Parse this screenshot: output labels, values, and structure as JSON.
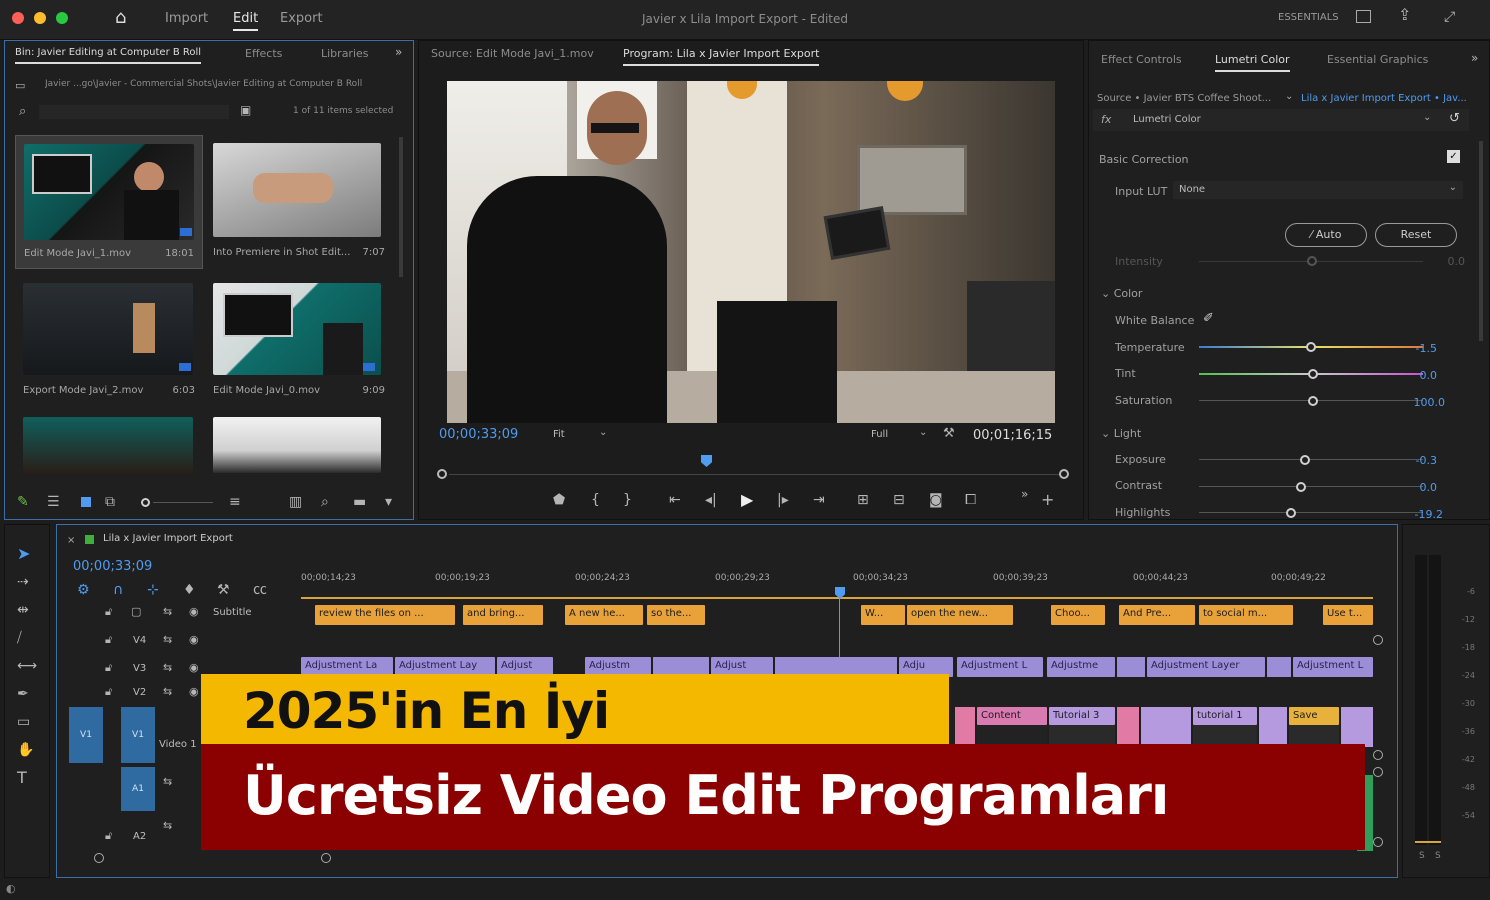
{
  "topbar": {
    "nav": [
      "Import",
      "Edit",
      "Export"
    ],
    "title": "Javier x Lila Import Export - Edited",
    "workspace": "ESSENTIALS"
  },
  "project_panel": {
    "tabs": [
      "Bin: Javier Editing at Computer B Roll",
      "Effects",
      "Libraries"
    ],
    "path": "Javier ...go\\Javier - Commercial Shots\\Javier Editing at Computer B Roll",
    "selection": "1 of 11 items selected",
    "items": [
      {
        "name": "Edit Mode Javi_1.mov",
        "duration": "18:01"
      },
      {
        "name": "Into Premiere in Shot Edit...",
        "duration": "7:07"
      },
      {
        "name": "Export Mode Javi_2.mov",
        "duration": "6:03"
      },
      {
        "name": "Edit Mode Javi_0.mov",
        "duration": "9:09"
      },
      {
        "name": "",
        "duration": ""
      },
      {
        "name": "",
        "duration": ""
      }
    ]
  },
  "monitor": {
    "tabs": [
      "Source: Edit Mode Javi_1.mov",
      "Program: Lila x Javier Import Export"
    ],
    "timecode_left": "00;00;33;09",
    "fit": "Fit",
    "quality": "Full",
    "timecode_right": "00;01;16;15"
  },
  "right_panel": {
    "tabs": [
      "Effect Controls",
      "Lumetri Color",
      "Essential Graphics"
    ],
    "source": "Source • Javier BTS Coffee Shoot...",
    "target": "Lila x Javier Import Export • Jav...",
    "effect": "Lumetri Color",
    "basic_correction": "Basic Correction",
    "input_lut_label": "Input LUT",
    "input_lut_value": "None",
    "auto": "Auto",
    "reset": "Reset",
    "intensity_label": "Intensity",
    "intensity_value": "0.0",
    "color_section": "Color",
    "white_balance": "White Balance",
    "rows": [
      {
        "label": "Temperature",
        "value": "-1.5",
        "pos": 0.5
      },
      {
        "label": "Tint",
        "value": "0.0",
        "pos": 0.5
      },
      {
        "label": "Saturation",
        "value": "100.0",
        "pos": 0.5
      }
    ],
    "light_section": "Light",
    "light_rows": [
      {
        "label": "Exposure",
        "value": "-0.3",
        "pos": 0.47
      },
      {
        "label": "Contrast",
        "value": "0.0",
        "pos": 0.5
      },
      {
        "label": "Highlights",
        "value": "-19.2",
        "pos": 0.41
      }
    ]
  },
  "timeline": {
    "sequence": "Lila x Javier Import Export",
    "timecode": "00;00;33;09",
    "ruler": [
      "00;00;14;23",
      "00;00;19;23",
      "00;00;24;23",
      "00;00;29;23",
      "00;00;34;23",
      "00;00;39;23",
      "00;00;44;23",
      "00;00;49;22"
    ],
    "tracks": [
      "Subtitle",
      "V4",
      "V3",
      "V2",
      "Video 1",
      "A1",
      "A2"
    ],
    "track_ids": [
      "V1",
      "V1",
      "A1"
    ],
    "captions": [
      "review the files on ...",
      "and bring...",
      "A new he...",
      "so the...",
      "W...",
      "open the new...",
      "Choo...",
      "And Pre...",
      "to social m...",
      "Use t..."
    ],
    "adjustments": [
      "Adjustment La",
      "Adjustment Lay",
      "Adjust",
      "Adjustm",
      "Adjust",
      "Adju",
      "Adjustment L",
      "Adjustme",
      "Adjustment Layer",
      "Adjustment L"
    ],
    "video_clips": [
      "Content",
      "Tutorial 3",
      "tutorial 1",
      "Save"
    ]
  },
  "meter_ticks": [
    "-6",
    "-12",
    "-18",
    "-24",
    "-30",
    "-36",
    "-42",
    "-48",
    "-54"
  ],
  "meter_bottom": [
    "S",
    "S"
  ],
  "banner": {
    "line1": "2025'in En İyi",
    "line2": "Ücretsiz Video Edit Programları"
  },
  "colors": {
    "accent_blue": "#4f9cf0",
    "caption_orange": "#e9a23a",
    "adjustment_purple": "#9c8ed6",
    "banner_yellow": "#f5b800",
    "banner_red": "#8b0000"
  }
}
